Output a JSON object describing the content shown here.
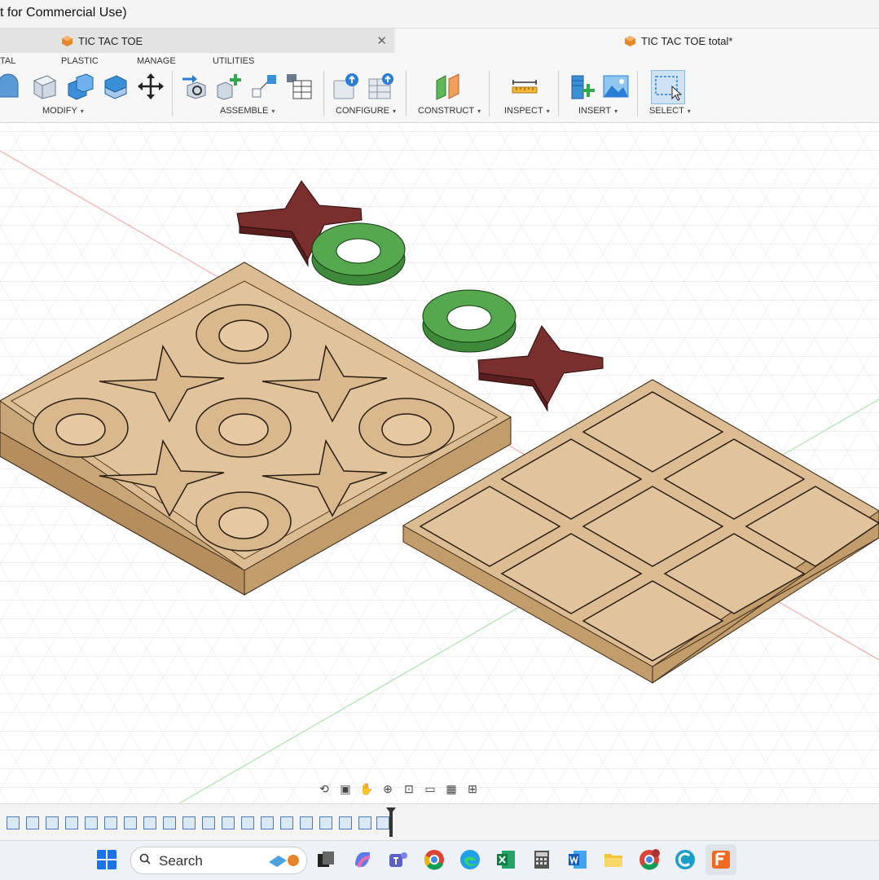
{
  "window": {
    "title": "t for Commercial Use)"
  },
  "tabs": [
    {
      "label": "TIC TAC TOE",
      "close_icon": "close-icon"
    },
    {
      "label": "TIC TAC TOE total*"
    }
  ],
  "ribbon": {
    "tabs": [
      "TAL",
      "PLASTIC",
      "MANAGE",
      "UTILITIES"
    ],
    "groups": [
      {
        "label": "MODIFY",
        "caret": "▾"
      },
      {
        "label": "ASSEMBLE",
        "caret": "▾"
      },
      {
        "label": "CONFIGURE",
        "caret": "▾"
      },
      {
        "label": "CONSTRUCT",
        "caret": "▾"
      },
      {
        "label": "INSPECT",
        "caret": "▾"
      },
      {
        "label": "INSERT",
        "caret": "▾"
      },
      {
        "label": "SELECT",
        "caret": "▾"
      }
    ]
  },
  "colors": {
    "wood": "#d9b88c",
    "wood_dark": "#8a6a45",
    "x_piece": "#7a2e2e",
    "o_piece": "#3f8a3a",
    "grid": "#e4e4e4",
    "axis_red": "#e88",
    "axis_green": "#8d8"
  },
  "taskbar": {
    "search_label": "Search",
    "apps": [
      "windows-start-icon",
      "search-icon",
      "task-view-icon",
      "copilot-icon",
      "teams-icon",
      "chrome-icon",
      "edge-icon",
      "excel-icon",
      "calculator-icon",
      "word-icon",
      "file-explorer-icon",
      "chrome-profile-icon",
      "ccleaner-icon",
      "fusion-icon"
    ]
  }
}
